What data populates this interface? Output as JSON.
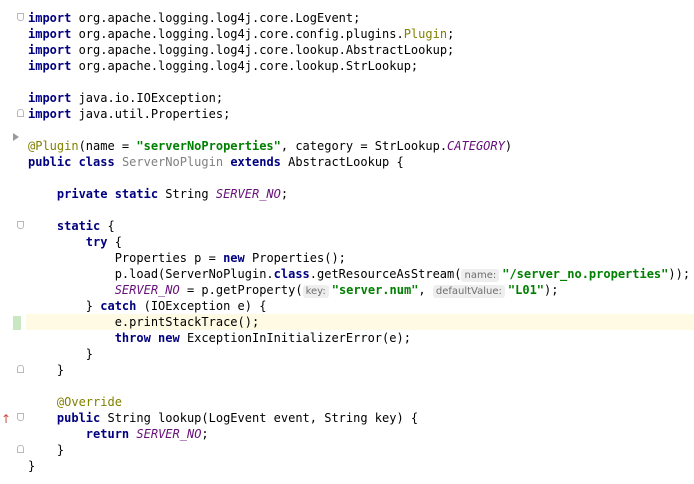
{
  "editor": {
    "language": "java",
    "gutter": {
      "run_icon": "run-arrow-icon",
      "override_icon": "override-arrow-icon",
      "fold_icon": "fold-toggle-icon",
      "change_marker_color": "#c9e7c1"
    },
    "colors": {
      "keyword": "#000080",
      "string": "#008000",
      "annotation": "#808000",
      "static_field": "#660e7a",
      "unused": "#808080",
      "current_line": "#fefae3"
    },
    "lines": {
      "l1_import": "import",
      "l1_rest": " org.apache.logging.log4j.core.LogEvent;",
      "l2_import": "import",
      "l2_rest": " org.apache.logging.log4j.core.config.plugins.",
      "l2_plugin": "Plugin",
      "l2_end": ";",
      "l3_import": "import",
      "l3_rest": " org.apache.logging.log4j.core.lookup.AbstractLookup;",
      "l4_import": "import",
      "l4_rest": " org.apache.logging.log4j.core.lookup.StrLookup;",
      "l6_import": "import",
      "l6_rest": " java.io.IOException;",
      "l7_import": "import",
      "l7_rest": " java.util.Properties;",
      "l9_ann": "@Plugin",
      "l9_a": "(name = ",
      "l9_str": "\"serverNoProperties\"",
      "l9_b": ", category = StrLookup.",
      "l9_const": "CATEGORY",
      "l9_c": ")",
      "l10_kw1": "public class",
      "l10_sp": " ",
      "l10_name": "ServerNoPlugin",
      "l10_sp2": " ",
      "l10_kw2": "extends",
      "l10_rest": " AbstractLookup {",
      "l12_indent": "    ",
      "l12_kw": "private static",
      "l12_a": " String ",
      "l12_field": "SERVER_NO",
      "l12_b": ";",
      "l14_indent": "    ",
      "l14_kw": "static",
      "l14_rest": " {",
      "l15_indent": "        ",
      "l15_kw": "try",
      "l15_rest": " {",
      "l16_a": "            Properties p = ",
      "l16_kw": "new",
      "l16_b": " Properties();",
      "l17_a": "            p.load(ServerNoPlugin.",
      "l17_kw": "class",
      "l17_b": ".getResourceAsStream(",
      "l17_hint": "name:",
      "l17_str": "\"/server_no.properties\"",
      "l17_c": "));",
      "l18_indent": "            ",
      "l18_field": "SERVER_NO",
      "l18_a": " = p.getProperty(",
      "l18_hint1": "key:",
      "l18_str1": "\"server.num\"",
      "l18_b": ", ",
      "l18_hint2": "defaultValue:",
      "l18_str2": "\"L01\"",
      "l18_c": ");",
      "l19_a": "        } ",
      "l19_kw": "catch",
      "l19_b": " (IOException e) {",
      "l20_a": "            e.printStackTrace();",
      "l21_indent": "            ",
      "l21_kw1": "throw new",
      "l21_b": " ExceptionInInitializerError(e);",
      "l22_a": "        }",
      "l23_a": "    }",
      "l25_indent": "    ",
      "l25_ann": "@Override",
      "l26_indent": "    ",
      "l26_kw": "public",
      "l26_b": " String lookup(LogEvent event, String key) {",
      "l27_indent": "        ",
      "l27_kw": "return",
      "l27_sp": " ",
      "l27_field": "SERVER_NO",
      "l27_b": ";",
      "l28_a": "    }",
      "l29_a": "}"
    }
  }
}
